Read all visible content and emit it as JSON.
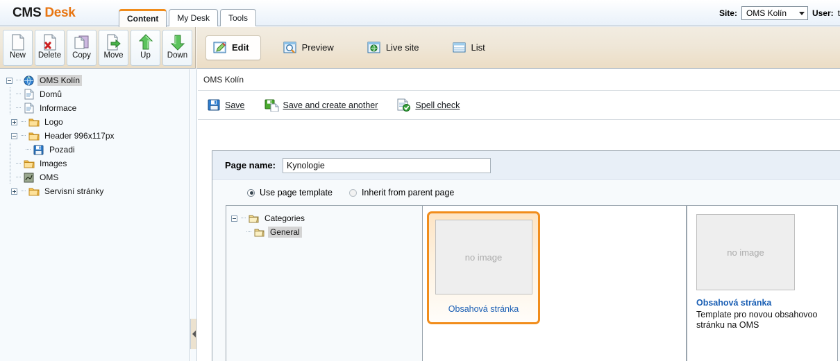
{
  "header": {
    "logo_cms": "CMS",
    "logo_desk": "Desk",
    "tabs": [
      {
        "label": "Content",
        "active": true
      },
      {
        "label": "My Desk",
        "active": false
      },
      {
        "label": "Tools",
        "active": false
      }
    ],
    "site_label": "Site:",
    "site_value": "OMS Kolín",
    "user_label": "User:",
    "user_value": "t"
  },
  "tree_toolbar": {
    "buttons": [
      {
        "label": "New",
        "icon": "new-page-icon"
      },
      {
        "label": "Delete",
        "icon": "delete-page-icon"
      },
      {
        "label": "Copy",
        "icon": "copy-page-icon"
      },
      {
        "label": "Move",
        "icon": "move-page-icon"
      },
      {
        "label": "Up",
        "icon": "arrow-up-icon"
      },
      {
        "label": "Down",
        "icon": "arrow-down-icon"
      }
    ]
  },
  "view_tabs": [
    {
      "label": "Edit",
      "icon": "edit-pencil-icon",
      "active": true
    },
    {
      "label": "Preview",
      "icon": "magnifier-icon",
      "active": false
    },
    {
      "label": "Live site",
      "icon": "globe-icon",
      "active": false
    },
    {
      "label": "List",
      "icon": "list-icon",
      "active": false
    }
  ],
  "tree": {
    "nodes": [
      {
        "label": "OMS Kolín",
        "icon": "globe-icon",
        "toggle": "minus",
        "depth": 0,
        "selected": true
      },
      {
        "label": "Domů",
        "icon": "document-icon",
        "toggle": "none",
        "depth": 1,
        "selected": false
      },
      {
        "label": "Informace",
        "icon": "document-icon",
        "toggle": "none",
        "depth": 1,
        "selected": false
      },
      {
        "label": "Logo",
        "icon": "folder-icon",
        "toggle": "plus",
        "depth": 1,
        "selected": false
      },
      {
        "label": "Header 996x117px",
        "icon": "folder-icon",
        "toggle": "minus",
        "depth": 1,
        "selected": false
      },
      {
        "label": "Pozadi",
        "icon": "floppy-icon",
        "toggle": "none",
        "depth": 2,
        "selected": false
      },
      {
        "label": "Images",
        "icon": "folder-icon",
        "toggle": "none",
        "depth": 1,
        "selected": false
      },
      {
        "label": "OMS",
        "icon": "app-icon",
        "toggle": "none",
        "depth": 1,
        "selected": false
      },
      {
        "label": "Servisní stránky",
        "icon": "folder-icon",
        "toggle": "plus",
        "depth": 1,
        "selected": false
      }
    ]
  },
  "content": {
    "breadcrumb": "OMS Kolín",
    "actions": [
      {
        "label": "Save",
        "icon": "floppy-save-icon"
      },
      {
        "label": "Save and create another",
        "icon": "save-new-icon"
      },
      {
        "label": "Spell check",
        "icon": "spell-check-icon"
      }
    ],
    "page_name_label": "Page name:",
    "page_name_value": "Kynologie",
    "page_name_placeholder": "",
    "template_mode": [
      {
        "label": "Use page template",
        "selected": true
      },
      {
        "label": "Inherit from parent page",
        "selected": false
      }
    ],
    "categories": [
      {
        "label": "Categories",
        "toggle": "minus",
        "depth": 0,
        "selected": false
      },
      {
        "label": "General",
        "toggle": "none",
        "depth": 1,
        "selected": true
      }
    ],
    "templates": [
      {
        "name": "Obsahová stránka",
        "thumb_text": "no image",
        "selected": true
      }
    ],
    "detail": {
      "thumb_text": "no image",
      "name": "Obsahová stránka",
      "description": "Template pro novou obsahovoo stránku na OMS"
    }
  },
  "colors": {
    "accent_orange": "#f18d1c",
    "link_blue": "#1a5fb4",
    "toolbar_beige": "#eedfc8",
    "panel_blue": "#e8eff7"
  }
}
